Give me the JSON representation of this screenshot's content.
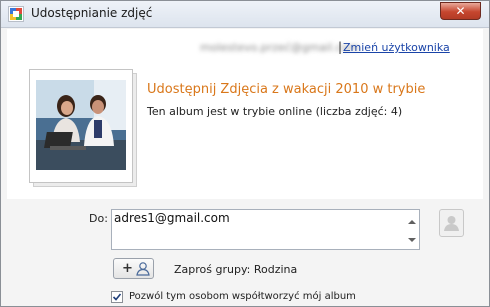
{
  "window": {
    "title": "Udostępnianie zdjęć",
    "close_glyph": "✕"
  },
  "account": {
    "email": "molestevo.przeć@gmail.com",
    "separator": "|",
    "change_user_label": "Zmień użytkownika"
  },
  "album": {
    "title": "Udostępnij Zdjęcia z wakacji 2010 w trybie",
    "subtitle": "Ten album jest w trybie online (liczba zdjęć: 4)"
  },
  "share": {
    "to_label": "Do:",
    "recipients_value": "adres1@gmail.com",
    "add_button_plus": "+",
    "invite_groups_text": "Zaproś grupy: Rodzina",
    "allow_collaboration_label": "Pozwól tym osobom współtworzyć mój album",
    "allow_collaboration_checked": true
  },
  "icons": {
    "app": "picasa-icon",
    "close": "close-icon",
    "contact": "contact-person-icon",
    "add_person": "add-person-icon",
    "check": "check-icon"
  },
  "colors": {
    "album_title": "#d9771a",
    "link": "#1a44a8",
    "close_button": "#c6462f"
  }
}
